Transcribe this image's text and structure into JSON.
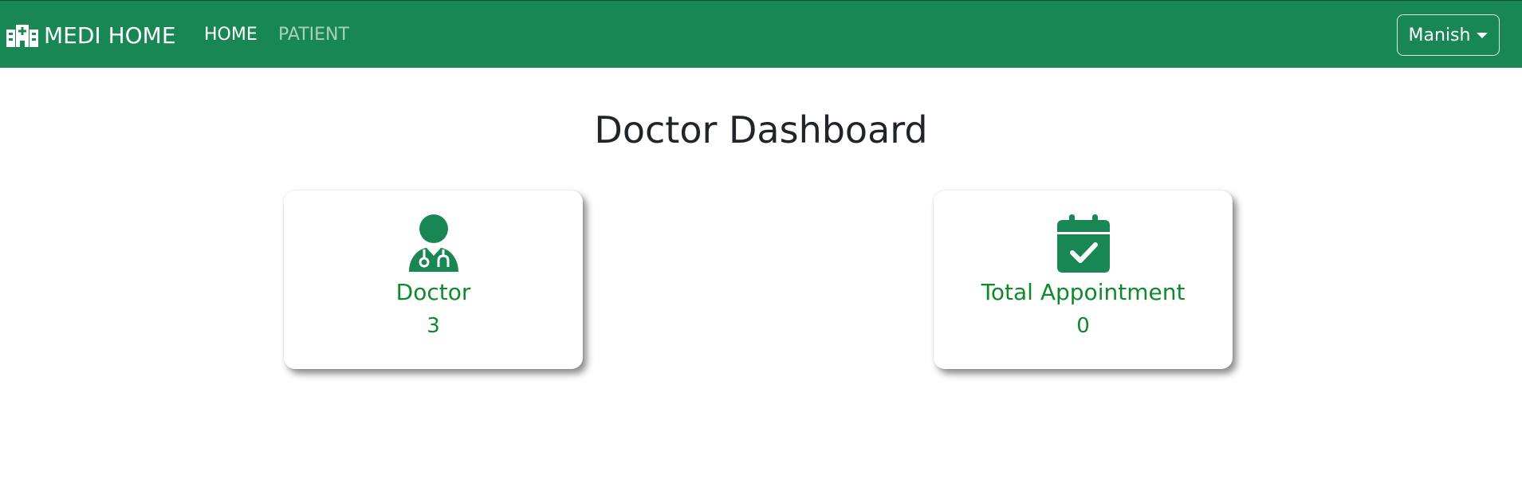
{
  "navbar": {
    "brand_icon": "hospital-icon",
    "brand": "MEDI HOME",
    "links": [
      {
        "label": "HOME",
        "active": true
      },
      {
        "label": "PATIENT",
        "active": false
      }
    ],
    "user": "Manish",
    "user_icon": "caret-down-icon"
  },
  "page": {
    "title": "Doctor Dashboard"
  },
  "cards": [
    {
      "icon": "doctor-icon",
      "label": "Doctor",
      "value": "3"
    },
    {
      "icon": "calendar-check-icon",
      "label": "Total Appointment",
      "value": "0"
    }
  ],
  "colors": {
    "primary": "#198754",
    "card_text": "#0f8a2b",
    "title_text": "#212529"
  }
}
